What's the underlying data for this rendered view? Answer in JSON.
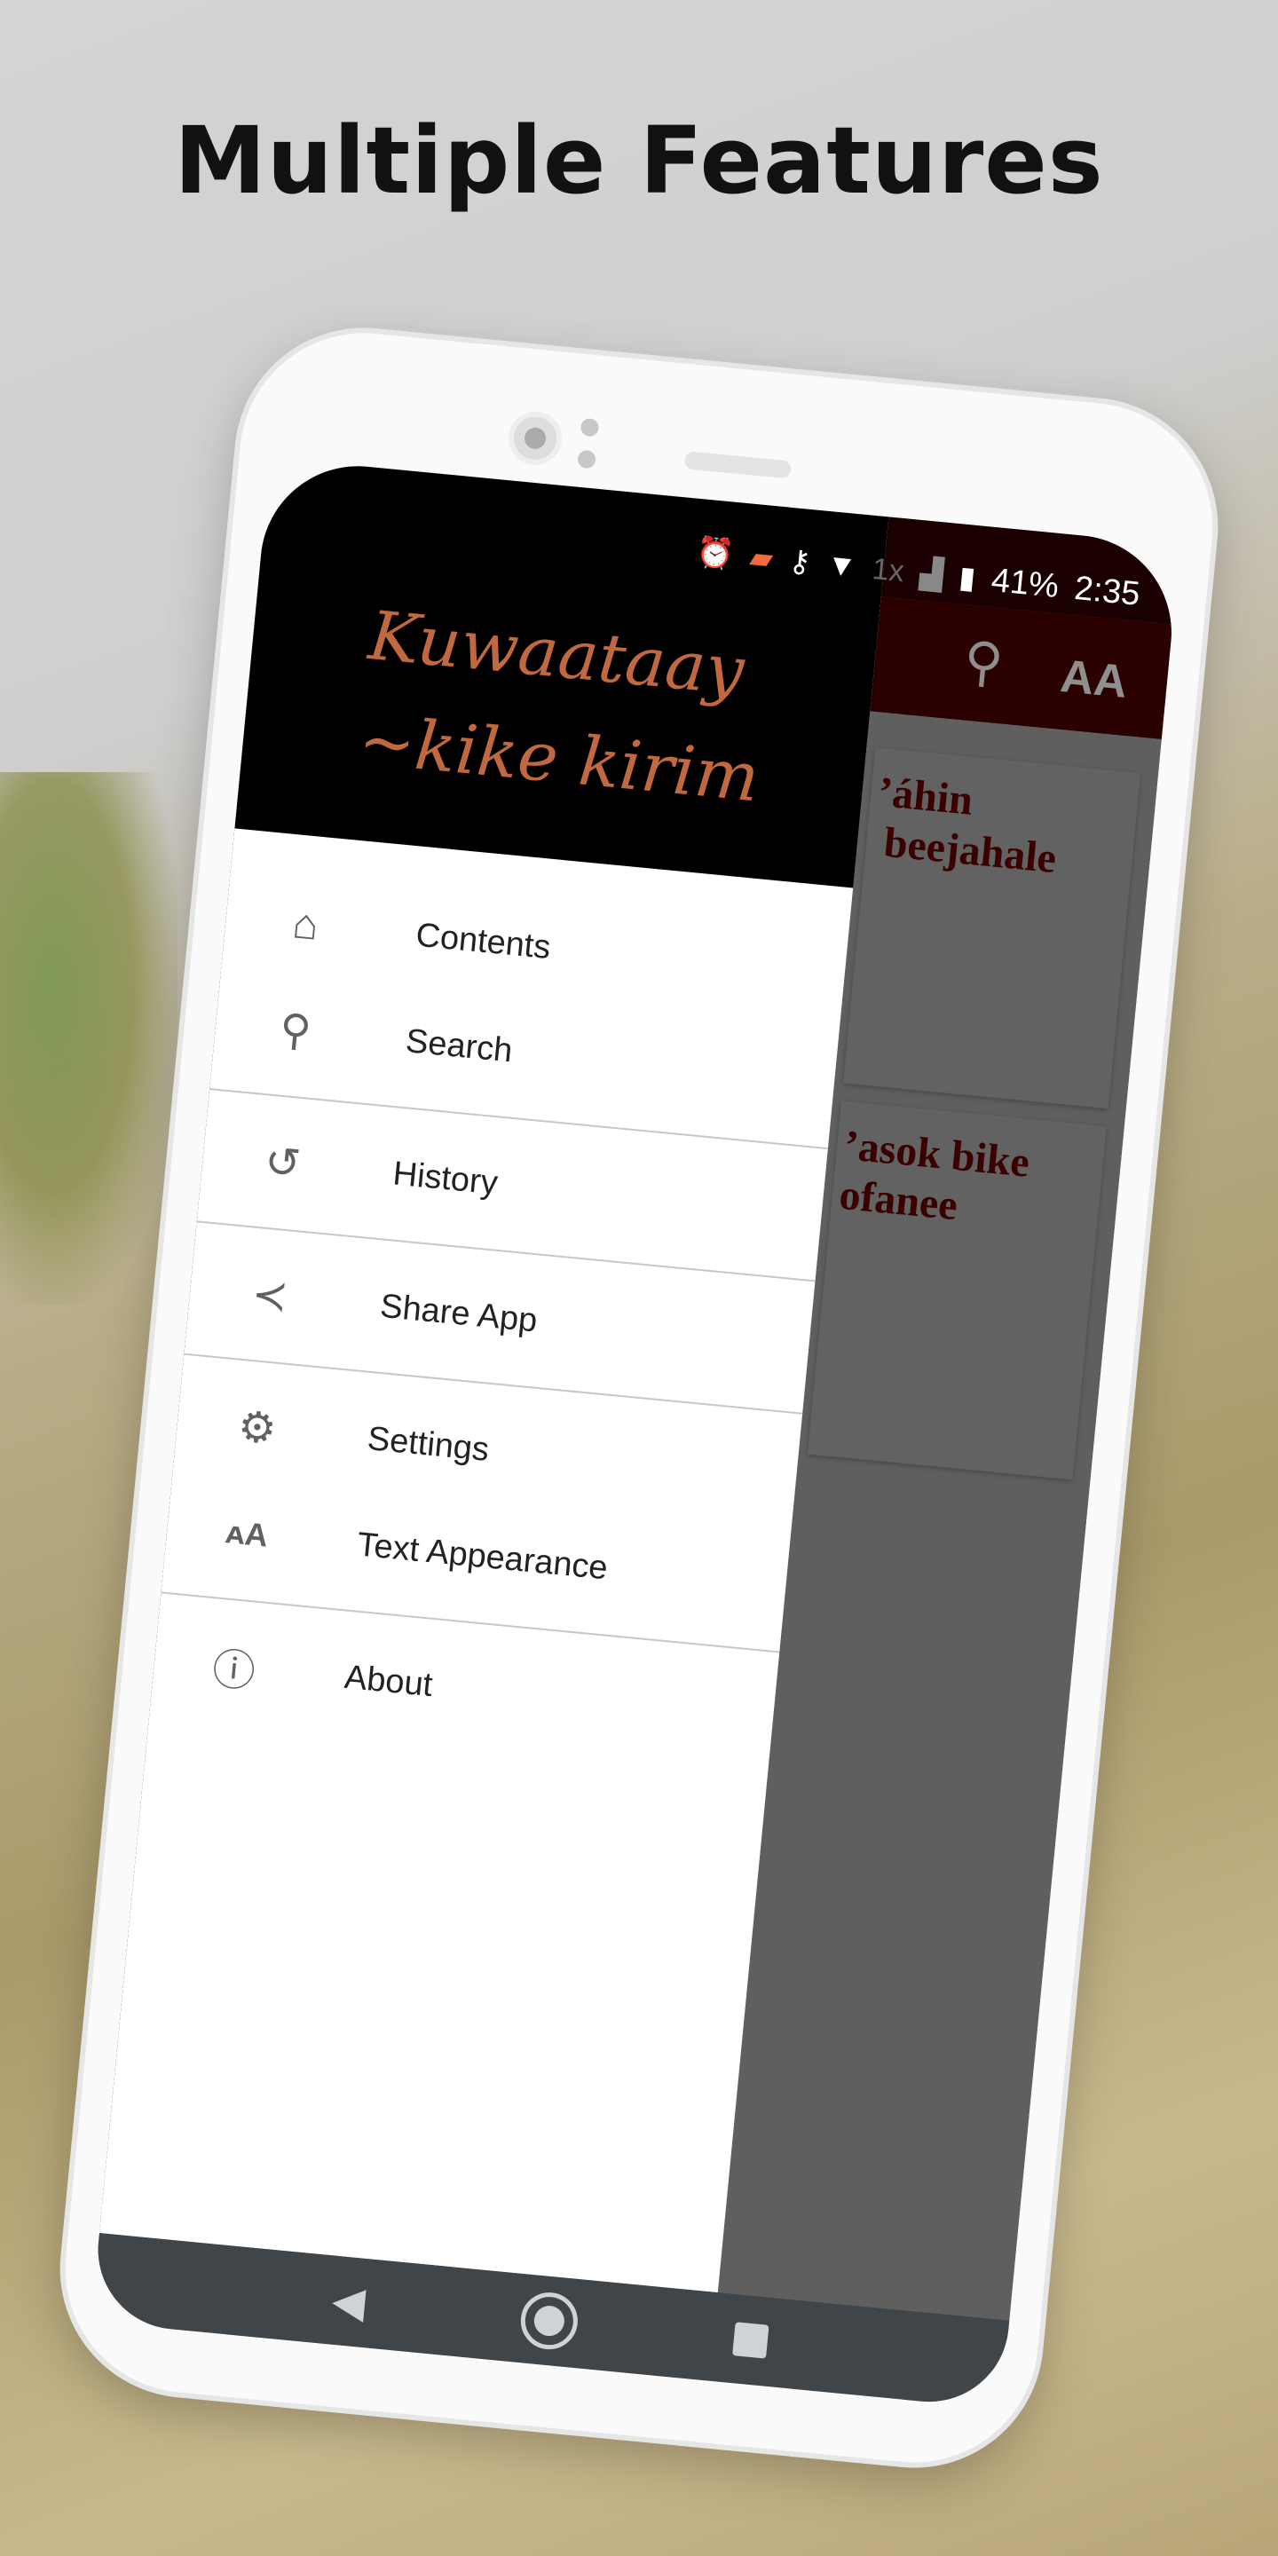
{
  "headline": "Multiple Features",
  "status_bar": {
    "battery": "41%",
    "time": "2:35",
    "icons": [
      "alarm-icon",
      "cast-icon",
      "vpn-key-icon",
      "wifi-icon",
      "data-off-icon",
      "signal-icon",
      "battery-icon"
    ]
  },
  "toolbar": {
    "icons": [
      "search-icon",
      "text-appearance-icon"
    ],
    "text_icon_label": "AA"
  },
  "content": {
    "cards": [
      {
        "title": "’áhin\n beejahale"
      },
      {
        "title": "’asok bike\nofanee"
      }
    ]
  },
  "drawer": {
    "logo": "Kuwaataay\n~kike kirim",
    "groups": [
      [
        {
          "label": "Contents",
          "icon": "home-icon"
        },
        {
          "label": "Search",
          "icon": "search-icon"
        }
      ],
      [
        {
          "label": "History",
          "icon": "history-icon"
        }
      ],
      [
        {
          "label": "Share App",
          "icon": "share-icon"
        }
      ],
      [
        {
          "label": "Settings",
          "icon": "gear-icon"
        },
        {
          "label": "Text Appearance",
          "icon": "text-appearance-icon"
        }
      ],
      [
        {
          "label": "About",
          "icon": "info-icon"
        }
      ]
    ]
  },
  "colors": {
    "toolbar": "#2a0000",
    "logo": "#c0683f",
    "card_title": "#3a0000",
    "navbar": "#3f4549"
  }
}
